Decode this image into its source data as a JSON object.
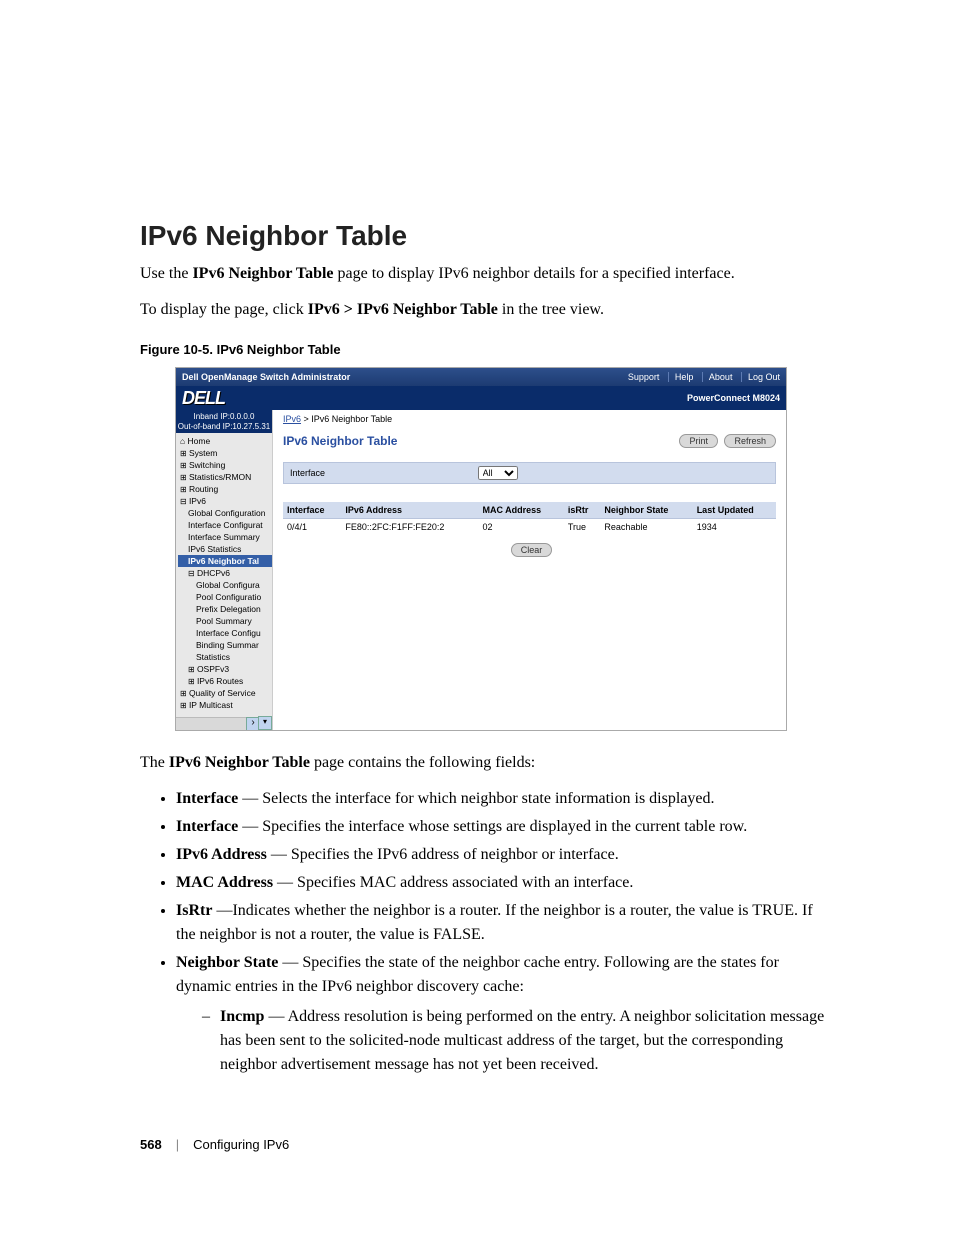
{
  "heading": "IPv6 Neighbor Table",
  "intro1_a": "Use the ",
  "intro1_b": "IPv6 Neighbor Table",
  "intro1_c": " page to display IPv6 neighbor details for a specified interface.",
  "intro2_a": "To display the page, click ",
  "intro2_b": "IPv6 > IPv6 Neighbor Table",
  "intro2_c": " in the tree view.",
  "figcap": "Figure 10-5.    IPv6 Neighbor Table",
  "shot": {
    "titlebar_left": "Dell OpenManage Switch Administrator",
    "titlebar_links": [
      "Support",
      "Help",
      "About",
      "Log Out"
    ],
    "brand": "DELL",
    "model": "PowerConnect M8024",
    "ip_line1": "Inband IP:0.0.0.0",
    "ip_line2": "Out-of-band IP:10.27.5.31",
    "tree": {
      "home": "Home",
      "system": "System",
      "switching": "Switching",
      "stats": "Statistics/RMON",
      "routing": "Routing",
      "ipv6": "IPv6",
      "gconf": "Global Configuration",
      "iconf": "Interface Configurat",
      "isum": "Interface Summary",
      "istat": "IPv6 Statistics",
      "ntab": "IPv6 Neighbor Tal",
      "dhcp": "DHCPv6",
      "dgconf": "Global Configura",
      "dpool": "Pool Configuratio",
      "dpref": "Prefix Delegation",
      "dpsum": "Pool Summary",
      "diconf": "Interface Configu",
      "dbind": "Binding Summar",
      "dstat": "Statistics",
      "ospf": "OSPFv3",
      "routes": "IPv6 Routes",
      "qos": "Quality of Service",
      "last": "IP Multicast"
    },
    "crumb_a": "IPv6",
    "crumb_sep": " > ",
    "crumb_b": "IPv6 Neighbor Table",
    "pane_title": "IPv6 Neighbor Table",
    "print": "Print",
    "refresh": "Refresh",
    "filter_label": "Interface",
    "filter_value": "All",
    "thead": [
      "Interface",
      "IPv6 Address",
      "MAC Address",
      "isRtr",
      "Neighbor State",
      "Last Updated"
    ],
    "row": [
      "0/4/1",
      "FE80::2FC:F1FF:FE20:2",
      "02",
      "True",
      "Reachable",
      "1934"
    ],
    "clear": "Clear"
  },
  "after_fig": "The IPv6 Neighbor Table page contains the following fields:",
  "after_fig_a": "The ",
  "after_fig_b": "IPv6 Neighbor Table",
  "after_fig_c": " page contains the following fields:",
  "bullets": {
    "b1_t": "Interface",
    "b1_r": " — Selects the interface for which neighbor state information is displayed.",
    "b2_t": "Interface",
    "b2_r": " — Specifies the interface whose settings are displayed in the current table row.",
    "b3_t": "IPv6 Address",
    "b3_r": " — Specifies the IPv6 address of neighbor or interface.",
    "b4_t": "MAC Address",
    "b4_r": " — Specifies MAC address associated with an interface.",
    "b5_t": "IsRtr",
    "b5_r": " —Indicates whether the neighbor is a router. If the neighbor is a router, the value is TRUE. If the neighbor is not a router, the value is FALSE.",
    "b6_t": "Neighbor State",
    "b6_r": " — Specifies the state of the neighbor cache entry. Following are the states for dynamic entries in the IPv6 neighbor discovery cache:",
    "s1_t": "Incmp",
    "s1_r": " — Address resolution is being performed on the entry. A neighbor solicitation message has been sent to the solicited-node multicast address of the target, but the corresponding neighbor advertisement message has not yet been received."
  },
  "footer": {
    "page": "568",
    "sep": "|",
    "chapter": "Configuring IPv6"
  }
}
